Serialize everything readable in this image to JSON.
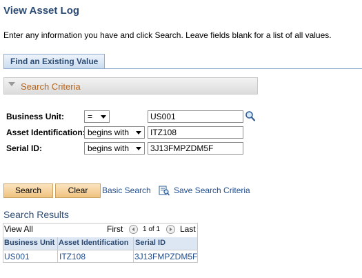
{
  "page": {
    "title": "View Asset Log",
    "instructions": "Enter any information you have and click Search. Leave fields blank for a list of all values."
  },
  "tabs": [
    {
      "label": "Find an Existing Value",
      "active": true
    }
  ],
  "search_criteria": {
    "title": "Search Criteria",
    "fields": [
      {
        "label": "Business Unit:",
        "operator": "=",
        "value": "US001",
        "has_lookup": true
      },
      {
        "label": "Asset Identification:",
        "operator": "begins with",
        "value": "ITZ108"
      },
      {
        "label": "Serial ID:",
        "operator": "begins with",
        "value": "3J13FMPZDM5F"
      }
    ]
  },
  "actions": {
    "search_label": "Search",
    "clear_label": "Clear",
    "basic_search_label": "Basic Search",
    "save_criteria_label": "Save Search Criteria"
  },
  "results": {
    "title": "Search Results",
    "view_all": "View All",
    "first": "First",
    "page_info": "1 of 1",
    "last": "Last",
    "columns": [
      "Business Unit",
      "Asset Identification",
      "Serial ID"
    ],
    "rows": [
      [
        "US001",
        "ITZ108",
        "3J13FMPZDM5F"
      ]
    ]
  },
  "colors": {
    "title_blue": "#2b4a73",
    "link_blue": "#1f4e91",
    "criteria_orange": "#b5651d",
    "button_orange": "#f0c37f"
  }
}
